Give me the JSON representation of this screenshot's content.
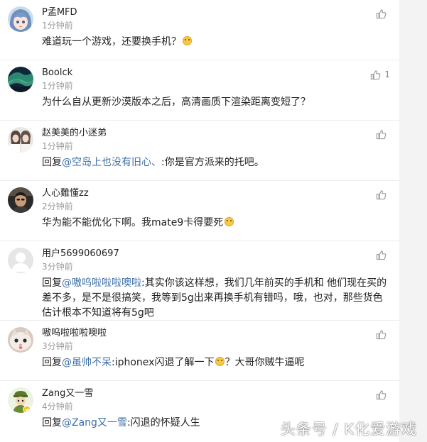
{
  "comments": [
    {
      "username": "P孟MFD",
      "time": "1分钟前",
      "text": "难道玩一个游戏，还要换手机？",
      "like_count": "",
      "avatar": "anime-girl-avatar",
      "emoji": "embarrassed-smile-emoji"
    },
    {
      "username": "Boolck",
      "time": "1分钟前",
      "text": "为什么自从更新沙漠版本之后，高清画质下渲染距离变短了？",
      "like_count": "1",
      "avatar": "aurora-landscape-avatar"
    },
    {
      "username": "赵美美的小迷弟",
      "time": "1分钟前",
      "reply_prefix": "回复",
      "mention": "@空岛上也没有旧心、",
      "text": ":你是官方派来的托吧。",
      "like_count": "",
      "avatar": "two-girls-photo-avatar"
    },
    {
      "username": "人心難懂zz",
      "time": "2分钟前",
      "text": "华为能不能优化下啊。我mate9卡得要死",
      "like_count": "",
      "avatar": "man-photo-avatar",
      "emoji": "smile-emoji"
    },
    {
      "username": "用户5699060697",
      "time": "3分钟前",
      "reply_prefix": "回复",
      "mention": "@嗷呜啦啦啦噢啦",
      "text": ":其实你该这样想，我们几年前买的手机和 他们现在买的差不多，是不是很搞笑，我等到5g出来再换手机有错吗，哦，也对，那些货色估计根本不知道将有5g吧",
      "like_count": "",
      "avatar": "default-user-avatar"
    },
    {
      "username": "嗷呜啦啦啦噢啦",
      "time": "3分钟前",
      "reply_prefix": "回复",
      "mention": "@虽帅不呆",
      "text": ":iphonex闪退了解一下",
      "text_after": "？大哥你贼牛逼呢",
      "like_count": "",
      "avatar": "cat-face-avatar",
      "emoji": "surprised-emoji"
    },
    {
      "username": "Zang又一雪",
      "time": "4分钟前",
      "reply_prefix": "回复",
      "mention": "@Zang又一雪",
      "text": ":闪退的怀疑人生",
      "like_count": "",
      "avatar": "soldier-cartoon-avatar"
    }
  ],
  "watermark": "头条号 / K化爱游戏",
  "colors": {
    "mention": "#3d6fa8",
    "time": "#999999",
    "like_icon": "#9a9a9a",
    "divider": "#ececec",
    "page_background": "#f3f3f3"
  }
}
